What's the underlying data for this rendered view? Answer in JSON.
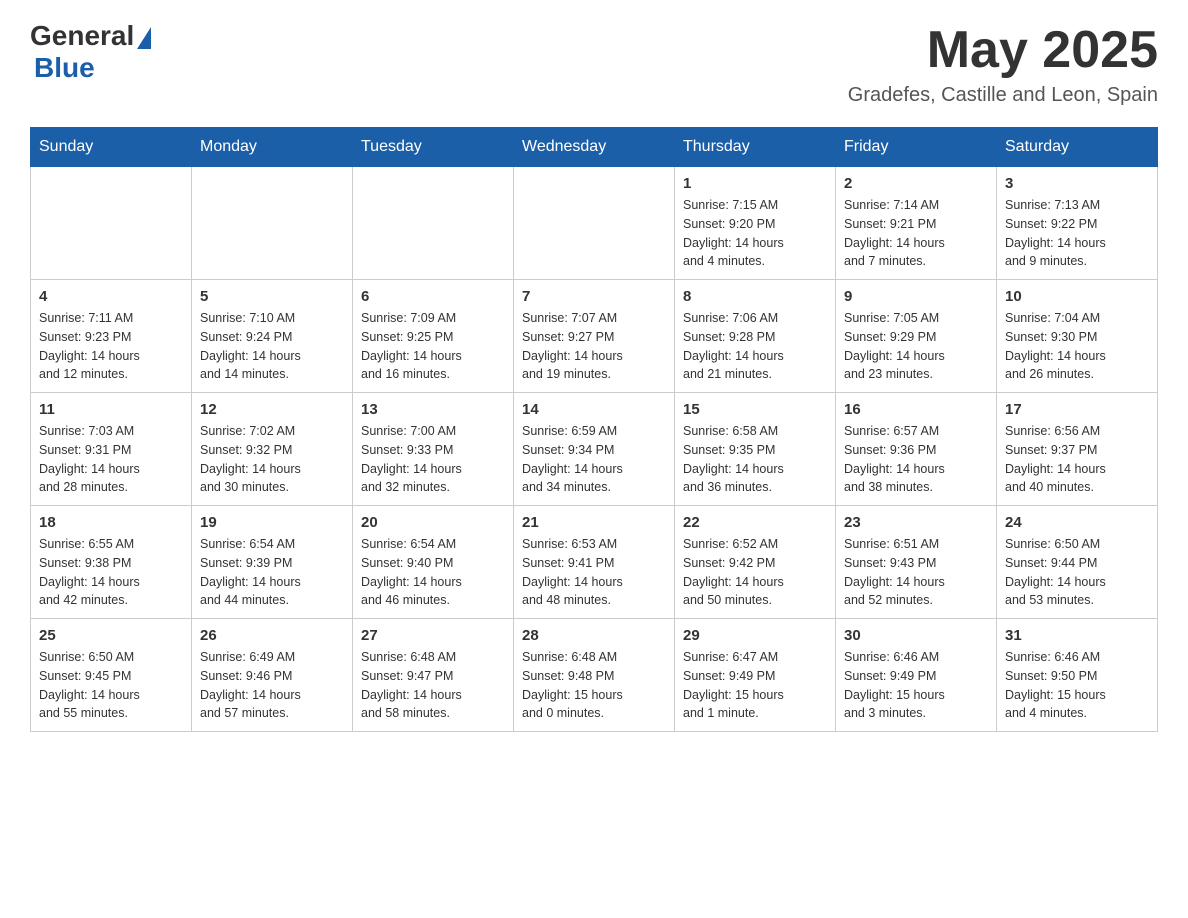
{
  "header": {
    "logo_general": "General",
    "logo_blue": "Blue",
    "month_title": "May 2025",
    "location": "Gradefes, Castille and Leon, Spain"
  },
  "weekdays": [
    "Sunday",
    "Monday",
    "Tuesday",
    "Wednesday",
    "Thursday",
    "Friday",
    "Saturday"
  ],
  "weeks": [
    [
      {
        "day": "",
        "info": ""
      },
      {
        "day": "",
        "info": ""
      },
      {
        "day": "",
        "info": ""
      },
      {
        "day": "",
        "info": ""
      },
      {
        "day": "1",
        "info": "Sunrise: 7:15 AM\nSunset: 9:20 PM\nDaylight: 14 hours\nand 4 minutes."
      },
      {
        "day": "2",
        "info": "Sunrise: 7:14 AM\nSunset: 9:21 PM\nDaylight: 14 hours\nand 7 minutes."
      },
      {
        "day": "3",
        "info": "Sunrise: 7:13 AM\nSunset: 9:22 PM\nDaylight: 14 hours\nand 9 minutes."
      }
    ],
    [
      {
        "day": "4",
        "info": "Sunrise: 7:11 AM\nSunset: 9:23 PM\nDaylight: 14 hours\nand 12 minutes."
      },
      {
        "day": "5",
        "info": "Sunrise: 7:10 AM\nSunset: 9:24 PM\nDaylight: 14 hours\nand 14 minutes."
      },
      {
        "day": "6",
        "info": "Sunrise: 7:09 AM\nSunset: 9:25 PM\nDaylight: 14 hours\nand 16 minutes."
      },
      {
        "day": "7",
        "info": "Sunrise: 7:07 AM\nSunset: 9:27 PM\nDaylight: 14 hours\nand 19 minutes."
      },
      {
        "day": "8",
        "info": "Sunrise: 7:06 AM\nSunset: 9:28 PM\nDaylight: 14 hours\nand 21 minutes."
      },
      {
        "day": "9",
        "info": "Sunrise: 7:05 AM\nSunset: 9:29 PM\nDaylight: 14 hours\nand 23 minutes."
      },
      {
        "day": "10",
        "info": "Sunrise: 7:04 AM\nSunset: 9:30 PM\nDaylight: 14 hours\nand 26 minutes."
      }
    ],
    [
      {
        "day": "11",
        "info": "Sunrise: 7:03 AM\nSunset: 9:31 PM\nDaylight: 14 hours\nand 28 minutes."
      },
      {
        "day": "12",
        "info": "Sunrise: 7:02 AM\nSunset: 9:32 PM\nDaylight: 14 hours\nand 30 minutes."
      },
      {
        "day": "13",
        "info": "Sunrise: 7:00 AM\nSunset: 9:33 PM\nDaylight: 14 hours\nand 32 minutes."
      },
      {
        "day": "14",
        "info": "Sunrise: 6:59 AM\nSunset: 9:34 PM\nDaylight: 14 hours\nand 34 minutes."
      },
      {
        "day": "15",
        "info": "Sunrise: 6:58 AM\nSunset: 9:35 PM\nDaylight: 14 hours\nand 36 minutes."
      },
      {
        "day": "16",
        "info": "Sunrise: 6:57 AM\nSunset: 9:36 PM\nDaylight: 14 hours\nand 38 minutes."
      },
      {
        "day": "17",
        "info": "Sunrise: 6:56 AM\nSunset: 9:37 PM\nDaylight: 14 hours\nand 40 minutes."
      }
    ],
    [
      {
        "day": "18",
        "info": "Sunrise: 6:55 AM\nSunset: 9:38 PM\nDaylight: 14 hours\nand 42 minutes."
      },
      {
        "day": "19",
        "info": "Sunrise: 6:54 AM\nSunset: 9:39 PM\nDaylight: 14 hours\nand 44 minutes."
      },
      {
        "day": "20",
        "info": "Sunrise: 6:54 AM\nSunset: 9:40 PM\nDaylight: 14 hours\nand 46 minutes."
      },
      {
        "day": "21",
        "info": "Sunrise: 6:53 AM\nSunset: 9:41 PM\nDaylight: 14 hours\nand 48 minutes."
      },
      {
        "day": "22",
        "info": "Sunrise: 6:52 AM\nSunset: 9:42 PM\nDaylight: 14 hours\nand 50 minutes."
      },
      {
        "day": "23",
        "info": "Sunrise: 6:51 AM\nSunset: 9:43 PM\nDaylight: 14 hours\nand 52 minutes."
      },
      {
        "day": "24",
        "info": "Sunrise: 6:50 AM\nSunset: 9:44 PM\nDaylight: 14 hours\nand 53 minutes."
      }
    ],
    [
      {
        "day": "25",
        "info": "Sunrise: 6:50 AM\nSunset: 9:45 PM\nDaylight: 14 hours\nand 55 minutes."
      },
      {
        "day": "26",
        "info": "Sunrise: 6:49 AM\nSunset: 9:46 PM\nDaylight: 14 hours\nand 57 minutes."
      },
      {
        "day": "27",
        "info": "Sunrise: 6:48 AM\nSunset: 9:47 PM\nDaylight: 14 hours\nand 58 minutes."
      },
      {
        "day": "28",
        "info": "Sunrise: 6:48 AM\nSunset: 9:48 PM\nDaylight: 15 hours\nand 0 minutes."
      },
      {
        "day": "29",
        "info": "Sunrise: 6:47 AM\nSunset: 9:49 PM\nDaylight: 15 hours\nand 1 minute."
      },
      {
        "day": "30",
        "info": "Sunrise: 6:46 AM\nSunset: 9:49 PM\nDaylight: 15 hours\nand 3 minutes."
      },
      {
        "day": "31",
        "info": "Sunrise: 6:46 AM\nSunset: 9:50 PM\nDaylight: 15 hours\nand 4 minutes."
      }
    ]
  ]
}
